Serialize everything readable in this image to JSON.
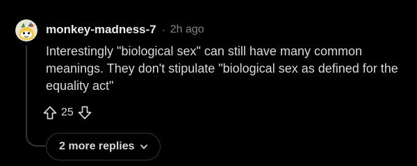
{
  "comment": {
    "username": "monkey-madness-7",
    "separator": "·",
    "timestamp": "2h ago",
    "body": "Interestingly \"biological sex\" can still have many common meanings. They don't stipulate \"biological sex as defined for the equality act\"",
    "score": "25",
    "more_replies_label": "2 more replies"
  },
  "icons": {
    "avatar": "snoo-avatar-icon",
    "upvote": "upvote-arrow-icon",
    "downvote": "downvote-arrow-icon",
    "expand": "chevron-down-icon"
  },
  "colors": {
    "background": "#000000",
    "text": "#d7dadc",
    "muted": "#818384",
    "border": "#343536",
    "avatar_yellow": "#f3c84a"
  }
}
